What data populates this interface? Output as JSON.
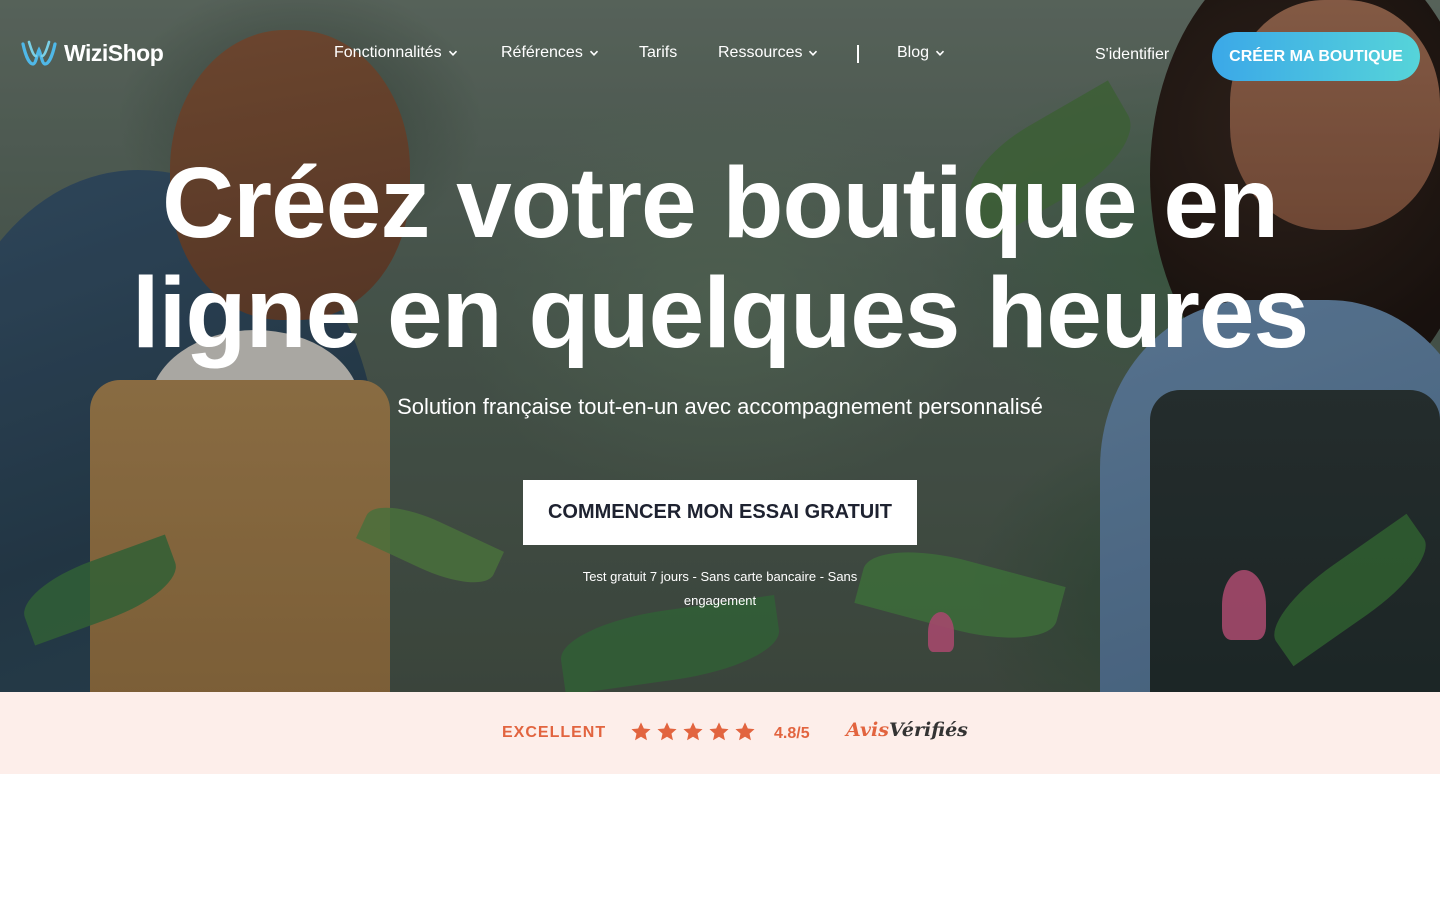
{
  "nav": {
    "logo_text": "WiziShop",
    "items": [
      {
        "label": "Fonctionnalités",
        "has_dropdown": true
      },
      {
        "label": "Références",
        "has_dropdown": true
      },
      {
        "label": "Tarifs",
        "has_dropdown": false
      },
      {
        "label": "Ressources",
        "has_dropdown": true
      },
      {
        "label": "Blog",
        "has_dropdown": true
      }
    ],
    "signin_label": "S'identifier",
    "cta_label": "CRÉER MA BOUTIQUE"
  },
  "hero": {
    "headline_line1": "Créez votre boutique en",
    "headline_line2": "ligne en quelques heures",
    "subheadline": "Solution française tout-en-un avec accompagnement personnalisé",
    "cta_label": "COMMENCER MON ESSAI GRATUIT",
    "note": "Test gratuit 7 jours - Sans carte bancaire - Sans engagement"
  },
  "rating": {
    "label": "EXCELLENT",
    "stars": 5,
    "score": "4.8/5",
    "brand_part1": "Avis",
    "brand_part2": "Vérifiés"
  },
  "colors": {
    "accent": "#e2643f",
    "cta_gradient_start": "#3ba8e8",
    "cta_gradient_end": "#56d4d9",
    "rating_band_bg": "#fdeeea"
  },
  "icons": {
    "logo": "wizishop-w-logo-icon",
    "dropdown": "chevron-down-icon",
    "rating": "star-icon"
  }
}
